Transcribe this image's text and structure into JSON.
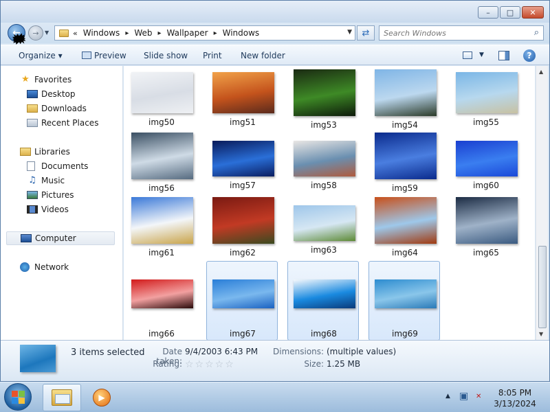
{
  "window": {
    "caption_buttons": {
      "minimize": "–",
      "maximize": "□",
      "close": "✕"
    }
  },
  "nav": {
    "back_icon": "←",
    "forward_icon": "→",
    "recent_icon": "▼",
    "breadcrumb_chevron": "«",
    "breadcrumb": [
      "Windows",
      "Web",
      "Wallpaper",
      "Windows"
    ],
    "separator": "▸",
    "address_dropdown": "▼",
    "refresh_icon": "⇄",
    "search_placeholder": "Search Windows",
    "search_icon": "⌕"
  },
  "toolbar": {
    "organize": "Organize ▾",
    "preview": "Preview",
    "slideshow": "Slide show",
    "print": "Print",
    "new_folder": "New folder",
    "view_dropdown": "▼",
    "help": "?"
  },
  "sidebar": {
    "favorites": {
      "label": "Favorites",
      "icon": "★",
      "items": [
        {
          "label": "Desktop",
          "icon": "desktop-icon"
        },
        {
          "label": "Downloads",
          "icon": "downloads-icon"
        },
        {
          "label": "Recent Places",
          "icon": "recent-places-icon"
        }
      ]
    },
    "libraries": {
      "label": "Libraries",
      "icon": "libraries-icon",
      "items": [
        {
          "label": "Documents",
          "icon": "documents-icon"
        },
        {
          "label": "Music",
          "icon": "♫"
        },
        {
          "label": "Pictures",
          "icon": "pictures-icon"
        },
        {
          "label": "Videos",
          "icon": "videos-icon"
        }
      ]
    },
    "computer": {
      "label": "Computer",
      "icon": "computer-icon"
    },
    "network": {
      "label": "Network",
      "icon": "network-icon"
    }
  },
  "files": [
    {
      "name": "img50",
      "selected": false,
      "colors": [
        "#f1f3f6",
        "#d8dde5",
        "#eef0f3"
      ]
    },
    {
      "name": "img51",
      "selected": false,
      "colors": [
        "#f1a24a",
        "#c4531c",
        "#5a2a1c"
      ]
    },
    {
      "name": "img53",
      "selected": false,
      "colors": [
        "#1a2a12",
        "#3e8a26",
        "#0d1a0a"
      ]
    },
    {
      "name": "img54",
      "selected": false,
      "colors": [
        "#7fb5e6",
        "#bcd8ef",
        "#2b3a28"
      ]
    },
    {
      "name": "img55",
      "selected": false,
      "colors": [
        "#7ab6e6",
        "#b7d8ee",
        "#c7c1a2"
      ]
    },
    {
      "name": "img56",
      "selected": false,
      "colors": [
        "#3a4f63",
        "#cfdbe6",
        "#566b80"
      ]
    },
    {
      "name": "img57",
      "selected": false,
      "colors": [
        "#081a5a",
        "#2a6fd8",
        "#0a1d60"
      ]
    },
    {
      "name": "img58",
      "selected": false,
      "colors": [
        "#e9e6e4",
        "#6a8fb0",
        "#b05a3c"
      ]
    },
    {
      "name": "img59",
      "selected": false,
      "colors": [
        "#0a2a8c",
        "#4a7ee0",
        "#0a2a8c"
      ]
    },
    {
      "name": "img60",
      "selected": false,
      "colors": [
        "#1a3fd0",
        "#3a7ef0",
        "#1a48d8"
      ]
    },
    {
      "name": "img61",
      "selected": false,
      "colors": [
        "#3a79d8",
        "#f3f6f9",
        "#c9a44a"
      ]
    },
    {
      "name": "img62",
      "selected": false,
      "colors": [
        "#7a1a12",
        "#c23a24",
        "#3a4a20"
      ]
    },
    {
      "name": "img63",
      "selected": false,
      "colors": [
        "#9ec6ea",
        "#d6e7f3",
        "#5d8a36"
      ]
    },
    {
      "name": "img64",
      "selected": false,
      "colors": [
        "#c8501a",
        "#9ec8ea",
        "#a03a10"
      ]
    },
    {
      "name": "img65",
      "selected": false,
      "colors": [
        "#1c2c44",
        "#9fb2c8",
        "#3a5a80"
      ]
    },
    {
      "name": "img66",
      "selected": false,
      "colors": [
        "#d21a1a",
        "#f2a0a0",
        "#2a0a0a"
      ]
    },
    {
      "name": "img67",
      "selected": true,
      "colors": [
        "#2a7ed8",
        "#7ab8ee",
        "#1a62c2"
      ]
    },
    {
      "name": "img68",
      "selected": true,
      "colors": [
        "#f5f8fc",
        "#1a8ae0",
        "#0a3a7a"
      ]
    },
    {
      "name": "img69",
      "selected": true,
      "colors": [
        "#2d8cd0",
        "#8ac6ea",
        "#2a7ab8"
      ]
    }
  ],
  "details": {
    "count": "3 items selected",
    "date_label": "Date taken:",
    "date_value": "9/4/2003 6:43 PM",
    "rating_label": "Rating:",
    "rating_stars": "☆☆☆☆☆",
    "dimensions_label": "Dimensions:",
    "dimensions_value": "(multiple values)",
    "size_label": "Size:",
    "size_value": "1.25 MB"
  },
  "taskbar": {
    "media_icon": "▶",
    "tray_arrow": "▲",
    "tray_network": "▣",
    "tray_volume": "✕",
    "time": "8:05 PM",
    "date": "3/13/2024",
    "flag_colors": [
      "#e8532a",
      "#7bc043",
      "#2a8ae0",
      "#f6c23a"
    ]
  }
}
